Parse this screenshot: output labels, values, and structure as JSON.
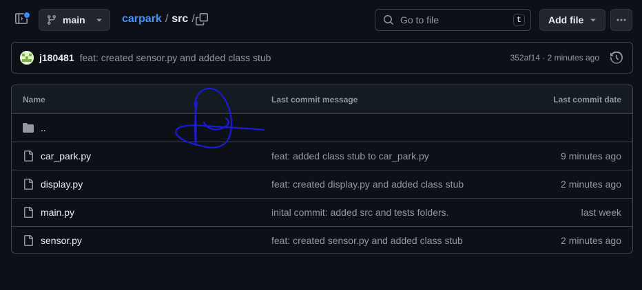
{
  "header": {
    "branch": "main",
    "breadcrumb": {
      "repo": "carpark",
      "sep1": "/",
      "folder": "src",
      "sep2": "/"
    },
    "search_placeholder": "Go to file",
    "search_shortcut": "t",
    "add_file_label": "Add file"
  },
  "latest_commit": {
    "author": "j180481",
    "message": "feat: created sensor.py and added class stub",
    "sha_time": "352af14 · 2 minutes ago"
  },
  "table": {
    "columns": {
      "name": "Name",
      "message": "Last commit message",
      "date": "Last commit date"
    },
    "parent": "..",
    "files": [
      {
        "name": "car_park.py",
        "message": "feat: added class stub to car_park.py",
        "date": "9 minutes ago"
      },
      {
        "name": "display.py",
        "message": "feat: created display.py and added class stub",
        "date": "2 minutes ago"
      },
      {
        "name": "main.py",
        "message": "inital commit: added src and tests folders.",
        "date": "last week"
      },
      {
        "name": "sensor.py",
        "message": "feat: created sensor.py and added class stub",
        "date": "2 minutes ago"
      }
    ]
  },
  "colors": {
    "background": "#0d1117",
    "link": "#4493f8",
    "border": "#3d444d",
    "annotation": "#1a1adb"
  },
  "icons": [
    "sidebar-icon",
    "git-branch-icon",
    "copy-icon",
    "search-icon",
    "kebab-icon",
    "history-icon",
    "folder-icon",
    "file-icon"
  ]
}
